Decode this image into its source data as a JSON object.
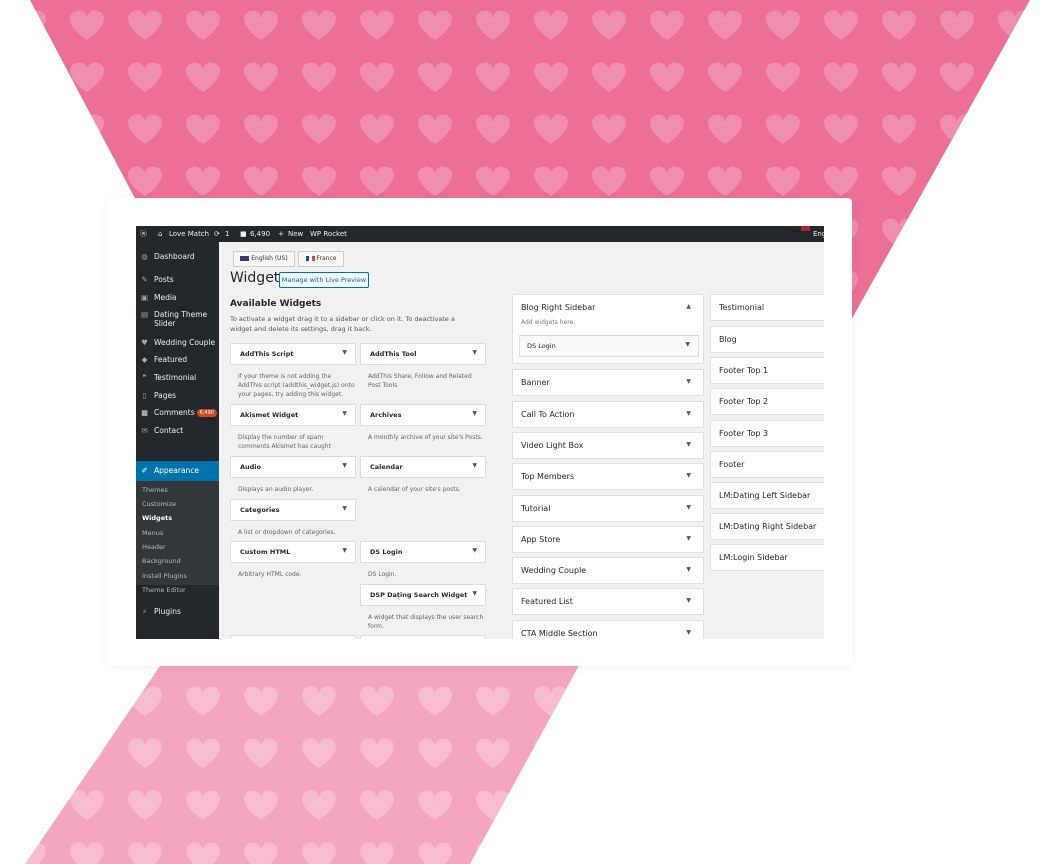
{
  "colors": {
    "pink_top": "#ec6f96",
    "pink_bottom": "#f4a6be",
    "admin_dark": "#23282d",
    "wp_blue": "#0073aa",
    "comment_badge": "#ca4a1f"
  },
  "adminbar": {
    "logo_icon": "wordpress-icon",
    "site_name": "Love Match",
    "updates": "1",
    "comments": "6,490",
    "new_label": "New",
    "rocket": "WP Rocket",
    "language": "Eng"
  },
  "sidebar": {
    "items": [
      {
        "icon": "dashboard-icon",
        "label": "Dashboard"
      },
      {
        "icon": "pin-icon",
        "label": "Posts"
      },
      {
        "icon": "media-icon",
        "label": "Media"
      },
      {
        "icon": "slider-icon",
        "label": "Dating Theme Slider"
      },
      {
        "icon": "heart-icon",
        "label": "Wedding Couple"
      },
      {
        "icon": "tag-icon",
        "label": "Featured"
      },
      {
        "icon": "quote-icon",
        "label": "Testimonial"
      },
      {
        "icon": "pages-icon",
        "label": "Pages"
      },
      {
        "icon": "comment-icon",
        "label": "Comments",
        "badge": "6,490"
      },
      {
        "icon": "mail-icon",
        "label": "Contact"
      },
      {
        "icon": "brush-icon",
        "label": "Appearance"
      },
      {
        "icon": "plugin-icon",
        "label": "Plugins"
      }
    ],
    "appearance_sub": [
      "Themes",
      "Customize",
      "Widgets",
      "Menus",
      "Header",
      "Background",
      "Install Plugins",
      "Theme Editor"
    ]
  },
  "lang_tabs": [
    {
      "label": "English (US)"
    },
    {
      "label": "France"
    }
  ],
  "page": {
    "title": "Widgets",
    "live_preview": "Manage with Live Preview",
    "available_title": "Available Widgets",
    "available_desc": "To activate a widget drag it to a sidebar or click on it. To deactivate a widget and delete its settings, drag it back."
  },
  "widgets_left": [
    {
      "name": "AddThis Script",
      "desc": "If your theme is not adding the AddThis script (addthis_widget.js) onto your pages, try adding this widget."
    },
    {
      "name": "Akismet Widget",
      "desc": "Display the number of spam comments Akismet has caught"
    },
    {
      "name": "Audio",
      "desc": "Displays an audio player."
    },
    {
      "name": "Categories",
      "desc": "A list or dropdown of categories."
    },
    {
      "name": "Custom HTML",
      "desc": "Arbitrary HTML code."
    }
  ],
  "widgets_right": [
    {
      "name": "AddThis Tool",
      "desc": "AddThis Share, Follow and Related Post Tools"
    },
    {
      "name": "Archives",
      "desc": "A monthly archive of your site's Posts."
    },
    {
      "name": "Calendar",
      "desc": "A calendar of your site's posts."
    },
    {
      "name": "DS Login",
      "desc": "DS Login."
    },
    {
      "name": "DSP Dating Search Widget",
      "desc": "A widget that displays the user search form."
    }
  ],
  "blog_right_sidebar": {
    "title": "Blog Right Sidebar",
    "hint": "Add widgets here.",
    "widget": "DS Login"
  },
  "sidebars_middle": [
    "Banner",
    "Call To Action",
    "Video Light Box",
    "Top Members",
    "Tutorial",
    "App Store",
    "Wedding Couple",
    "Featured List",
    "CTA Middle Section"
  ],
  "sidebars_right": [
    "Testimonial",
    "Blog",
    "Footer Top 1",
    "Footer Top 2",
    "Footer Top 3",
    "Footer",
    "LM:Dating Left Sidebar",
    "LM:Dating Right Sidebar",
    "LM:Login Sidebar"
  ]
}
